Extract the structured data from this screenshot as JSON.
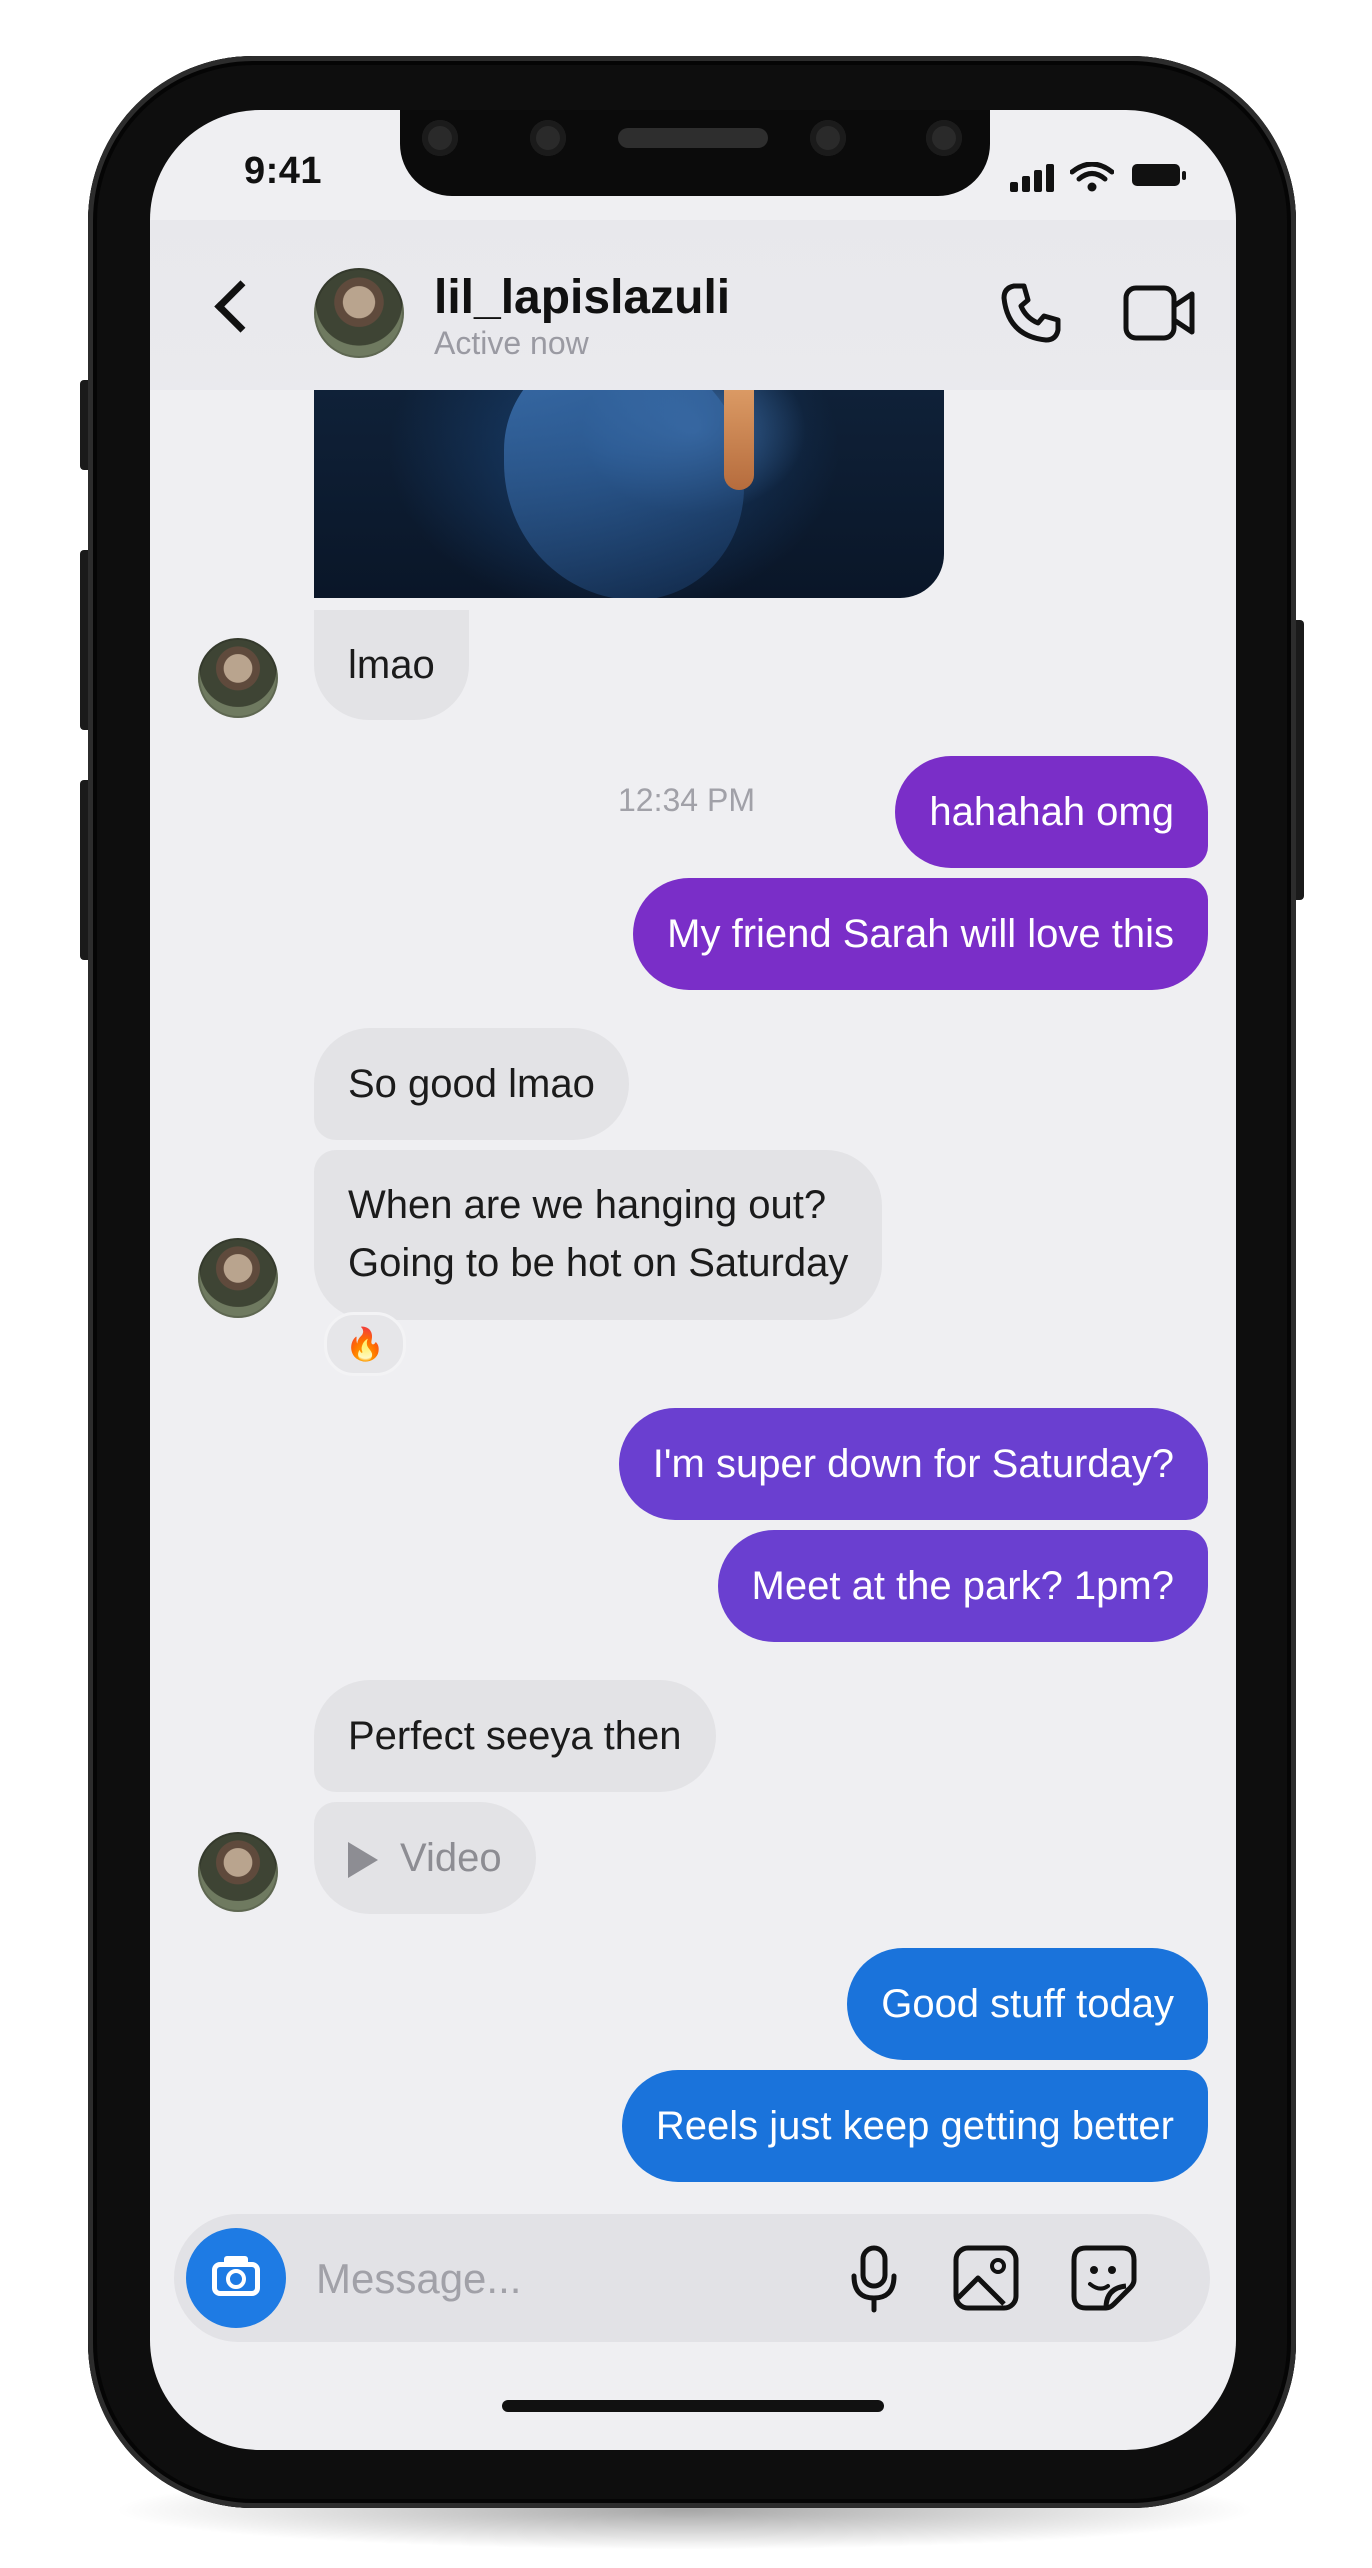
{
  "status_bar": {
    "time": "9:41"
  },
  "header": {
    "contact_name": "lil_lapislazuli",
    "contact_status": "Active now"
  },
  "messages": [
    {
      "direction": "in",
      "text": "lmao"
    },
    {
      "direction": "out",
      "text": "hahahah omg"
    },
    {
      "direction": "out",
      "text": "My friend Sarah will love this"
    },
    {
      "direction": "in",
      "text": "So good lmao"
    },
    {
      "direction": "in",
      "text_line1": "When are we hanging out?",
      "text_line2": "Going to be hot on Saturday"
    },
    {
      "direction": "out",
      "text": "I'm super down for Saturday?"
    },
    {
      "direction": "out",
      "text": "Meet at the park? 1pm?"
    },
    {
      "direction": "in",
      "text": "Perfect seeya then"
    },
    {
      "direction": "in",
      "type": "video",
      "text": "Video"
    },
    {
      "direction": "out",
      "text": "Good stuff today"
    },
    {
      "direction": "out",
      "text": "Reels just keep getting better"
    }
  ],
  "timestamp": "12:34 PM",
  "reaction": "🔥",
  "composer": {
    "placeholder": "Message..."
  },
  "colors": {
    "bubble_in": "#e3e3e6",
    "bubble_purple": "#7a2ec8",
    "bubble_violet": "#6a3fd0",
    "bubble_blue": "#1a73db",
    "camera_button": "#1e7be4"
  }
}
